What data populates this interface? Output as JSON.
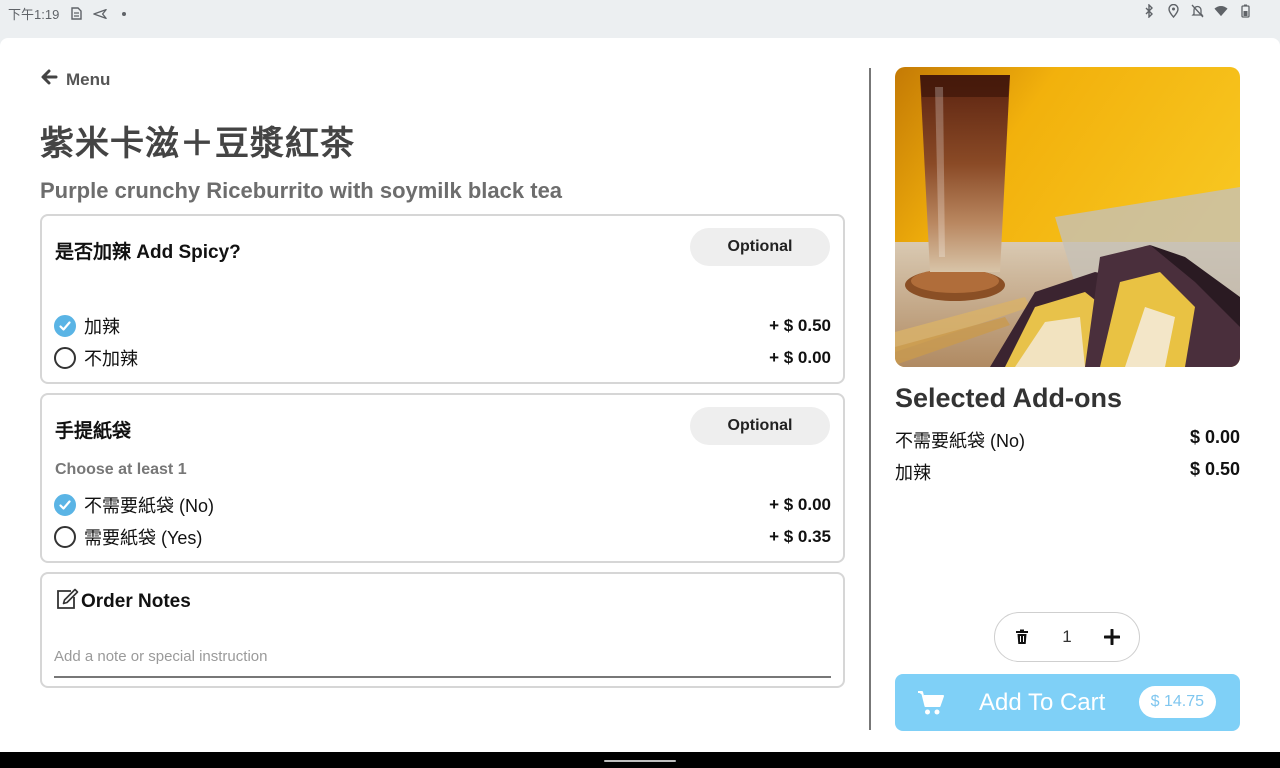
{
  "status_bar": {
    "time": "下午1:19",
    "icons": [
      "sim-icon",
      "send-icon",
      "dot-icon",
      "bluetooth-icon",
      "location-icon",
      "notifications-off-icon",
      "wifi-icon",
      "battery-icon"
    ]
  },
  "header": {
    "back_label": "Menu",
    "title_zh": "紫米卡滋＋豆漿紅茶",
    "title_en": "Purple crunchy Riceburrito with soymilk black tea"
  },
  "groups": [
    {
      "title": "是否加辣 Add Spicy?",
      "badge": "Optional",
      "hint": "",
      "options": [
        {
          "label": "加辣",
          "price": "+ $ 0.50",
          "selected": true
        },
        {
          "label": "不加辣",
          "price": "+ $ 0.00",
          "selected": false
        }
      ]
    },
    {
      "title": "手提紙袋",
      "badge": "Optional",
      "hint": "Choose at least 1",
      "options": [
        {
          "label": "不需要紙袋 (No)",
          "price": "+ $ 0.00",
          "selected": true
        },
        {
          "label": "需要紙袋 (Yes)",
          "price": "+ $ 0.35",
          "selected": false
        }
      ]
    }
  ],
  "notes": {
    "title": "Order Notes",
    "placeholder": "Add a note or special instruction",
    "value": ""
  },
  "summary": {
    "title": "Selected Add-ons",
    "items": [
      {
        "label": "不需要紙袋 (No)",
        "price": "$ 0.00"
      },
      {
        "label": "加辣",
        "price": "$ 0.50"
      }
    ]
  },
  "quantity": "1",
  "cart": {
    "label": "Add To Cart",
    "price": "$ 14.75"
  },
  "colors": {
    "accent": "#5ab4e5",
    "cart_button": "#7fd0f7",
    "divider": "#777777"
  }
}
